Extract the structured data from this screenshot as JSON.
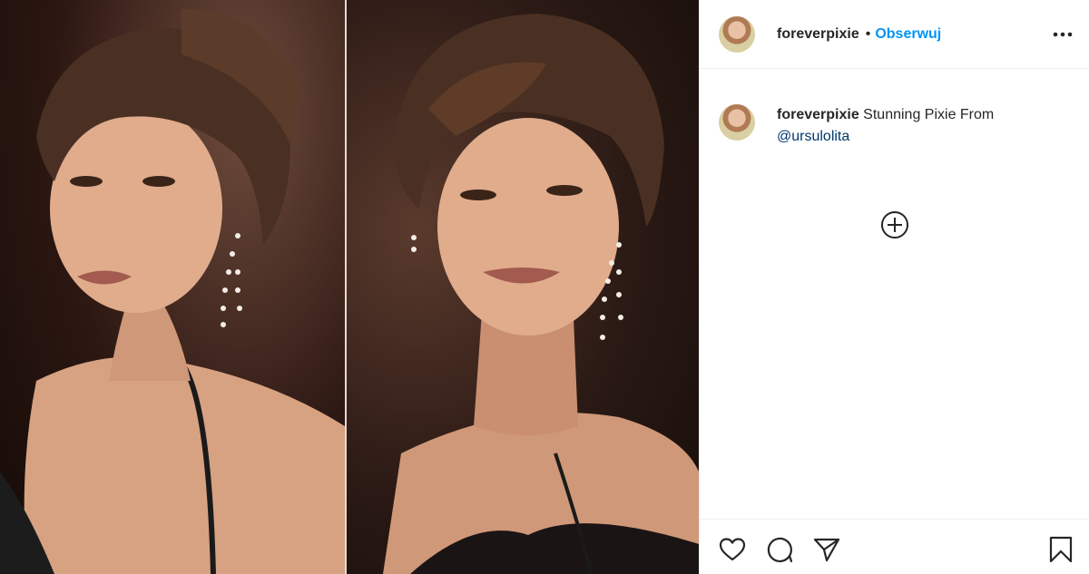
{
  "post": {
    "media": {
      "description_icons": [
        "photo-left",
        "photo-right"
      ]
    },
    "header": {
      "username": "foreverpixie",
      "separator": "•",
      "follow_label": "Obserwuj",
      "more_icon": "more-dots-icon"
    },
    "caption": {
      "username": "foreverpixie",
      "text": "Stunning Pixie From",
      "mention": "@ursulolita"
    },
    "load_more_icon": "plus-circle-icon",
    "actions": {
      "like_icon": "heart-icon",
      "comment_icon": "comment-bubble-icon",
      "share_icon": "paper-plane-icon",
      "save_icon": "bookmark-icon"
    }
  }
}
